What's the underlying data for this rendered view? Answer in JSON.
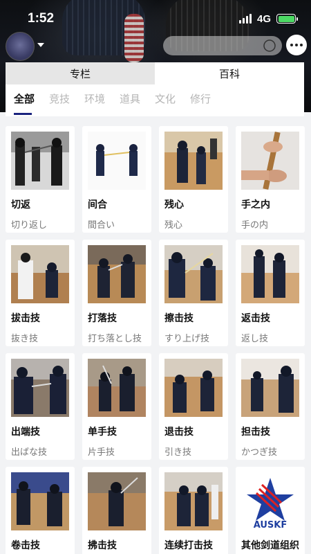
{
  "status_bar": {
    "time": "1:52",
    "network": "4G"
  },
  "header": {
    "search_placeholder": ""
  },
  "segments": [
    {
      "label": "专栏",
      "active": false
    },
    {
      "label": "百科",
      "active": true
    }
  ],
  "categories": [
    "全部",
    "竞技",
    "环境",
    "道具",
    "文化",
    "修行"
  ],
  "selected_category": "全部",
  "colors": {
    "accent": "#1a237e",
    "battery": "#4cd964"
  },
  "cards": [
    {
      "title": "切返",
      "subtitle": "切り返し"
    },
    {
      "title": "间合",
      "subtitle": "間合い"
    },
    {
      "title": "残心",
      "subtitle": "残心"
    },
    {
      "title": "手之内",
      "subtitle": "手の内"
    },
    {
      "title": "拔击技",
      "subtitle": "抜き技"
    },
    {
      "title": "打落技",
      "subtitle": "打ち落とし技"
    },
    {
      "title": "擦击技",
      "subtitle": "すり上げ技"
    },
    {
      "title": "返击技",
      "subtitle": "返し技"
    },
    {
      "title": "出端技",
      "subtitle": "出ばな技"
    },
    {
      "title": "单手技",
      "subtitle": "片手技"
    },
    {
      "title": "退击技",
      "subtitle": "引き技"
    },
    {
      "title": "担击技",
      "subtitle": "かつぎ技"
    },
    {
      "title": "卷击技",
      "subtitle": ""
    },
    {
      "title": "拂击技",
      "subtitle": ""
    },
    {
      "title": "连续打击技",
      "subtitle": ""
    },
    {
      "title": "其他剑道组织",
      "subtitle": ""
    }
  ],
  "ausk_logo_text": "AUSKF"
}
